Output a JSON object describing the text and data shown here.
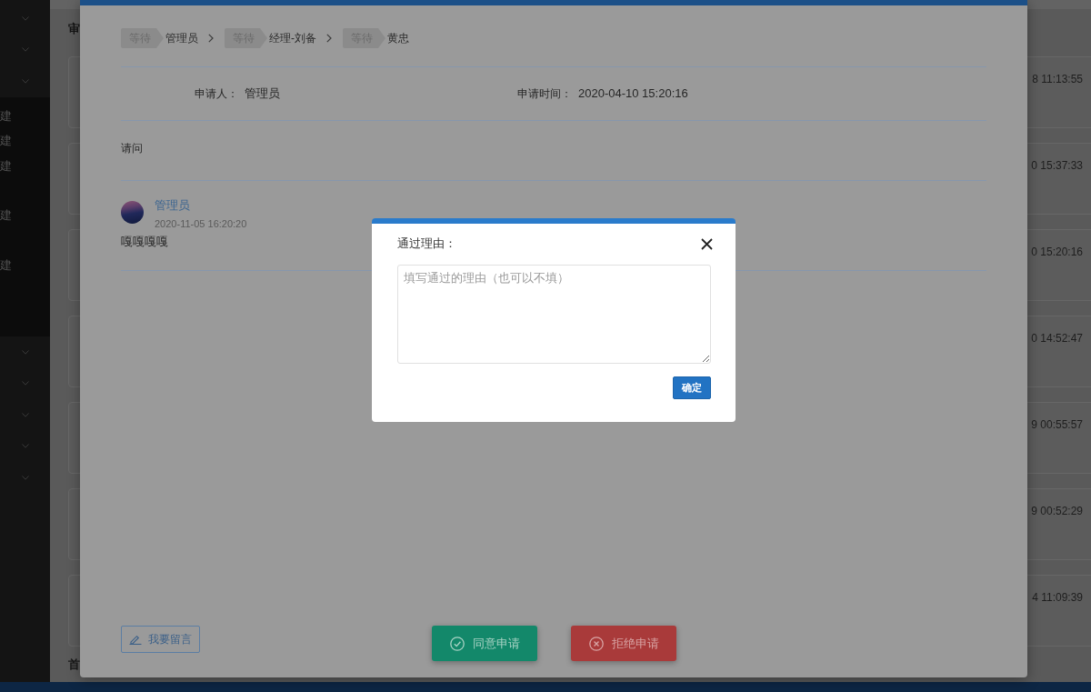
{
  "sidebar": {
    "menus": [
      {
        "expanded": false
      },
      {
        "expanded": false
      },
      {
        "expanded": true,
        "children": [
          {
            "label": "建"
          },
          {
            "label": "建"
          },
          {
            "label": "建"
          },
          {
            "children": [
              {
                "label": "建"
              }
            ]
          },
          {
            "children": [
              {
                "label": "建"
              }
            ]
          }
        ]
      },
      {
        "expanded": false
      },
      {
        "expanded": false
      },
      {
        "expanded": false
      },
      {
        "expanded": false
      },
      {
        "expanded": false
      }
    ]
  },
  "page": {
    "title": "审",
    "cards": [
      {
        "time": "8 11:13:55"
      },
      {
        "time": "0 15:37:33"
      },
      {
        "time": "0 15:20:16"
      },
      {
        "time": "0 14:52:47"
      },
      {
        "time": "9 00:55:57"
      },
      {
        "time": "9 00:52:29"
      },
      {
        "time": "4 11:09:39"
      }
    ],
    "bottom_text": "首"
  },
  "detail_modal": {
    "approval_steps": [
      {
        "status": "等待",
        "approver": "管理员"
      },
      {
        "status": "等待",
        "approver": "经理-刘备"
      },
      {
        "status": "等待",
        "approver": "黄忠"
      }
    ],
    "fields": [
      {
        "label": "申请人：",
        "value": "管理员"
      },
      {
        "label": "申请时间：",
        "value": "2020-04-10 15:20:16"
      }
    ],
    "content": "请问",
    "comments": [
      {
        "author": "管理员",
        "time": "2020-11-05 16:20:20",
        "text": "嘎嘎嘎嘎"
      }
    ],
    "comment_button": "我要留言",
    "actions": [
      {
        "kind": "approve",
        "label": "同意申请"
      },
      {
        "kind": "reject",
        "label": "拒绝申请"
      }
    ]
  },
  "reason_dialog": {
    "title": "通过理由：",
    "placeholder": "填写通过的理由（也可以不填）",
    "confirm": "确定"
  }
}
